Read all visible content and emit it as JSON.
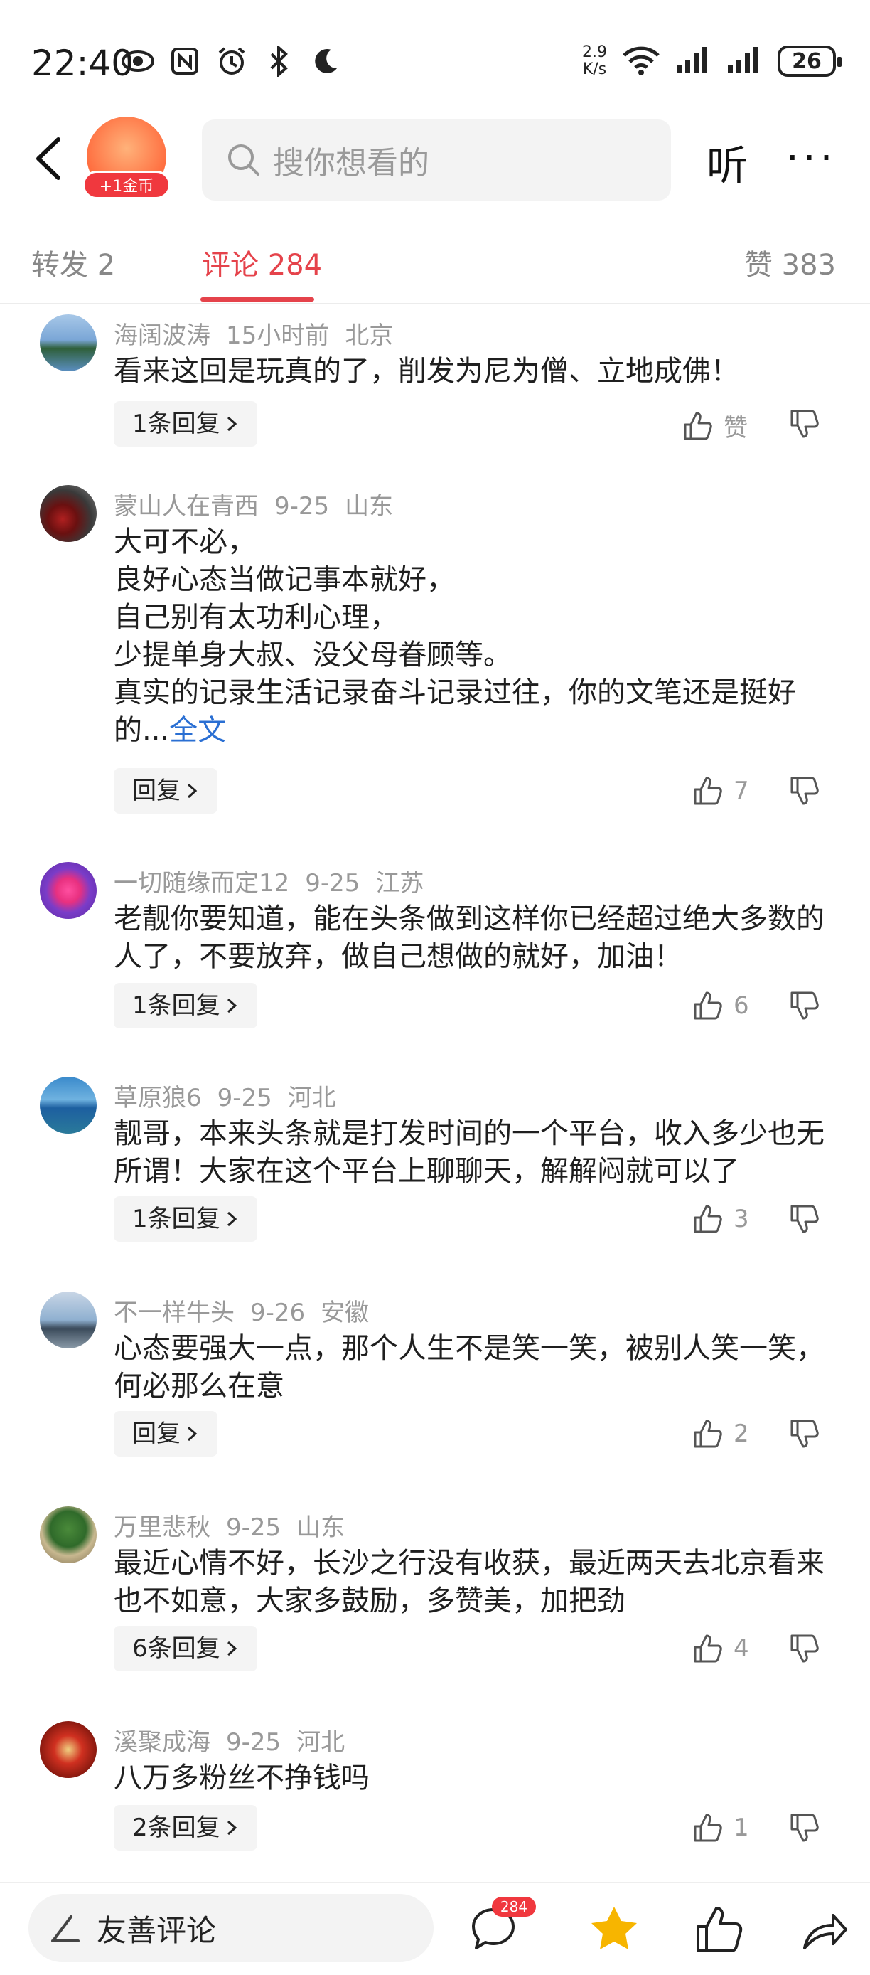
{
  "status_bar": {
    "time": "22:40",
    "net_speed_value": "2.9",
    "net_speed_unit": "K/s",
    "battery": "26"
  },
  "search": {
    "placeholder": "搜你想看的"
  },
  "coin_badge": "+1金币",
  "listen_label": "听",
  "more_label": "···",
  "tabs": {
    "share": "转发 2",
    "comments": "评论 284",
    "likes": "赞 383"
  },
  "comments": [
    {
      "user": "海阔波涛",
      "time": "15小时前",
      "location": "北京",
      "text": "看来这回是玩真的了，削发为尼为僧、立地成佛！",
      "reply": "1条回复",
      "likes": "赞"
    },
    {
      "user": "蒙山人在青西",
      "time": "9-25",
      "location": "山东",
      "text": "大可不必，\n良好心态当做记事本就好，\n自己别有太功利心理，\n少提单身大叔、没父母眷顾等。\n真实的记录生活记录奋斗记录过往，你的文笔还是挺好的...",
      "full_text_label": "全文",
      "reply": "回复",
      "likes": "7"
    },
    {
      "user": "一切随缘而定12",
      "time": "9-25",
      "location": "江苏",
      "text": "老靓你要知道，能在头条做到这样你已经超过绝大多数的人了，不要放弃，做自己想做的就好，加油！",
      "reply": "1条回复",
      "likes": "6"
    },
    {
      "user": "草原狼6",
      "time": "9-25",
      "location": "河北",
      "text": "靓哥，本来头条就是打发时间的一个平台，收入多少也无所谓！大家在这个平台上聊聊天，解解闷就可以了",
      "reply": "1条回复",
      "likes": "3"
    },
    {
      "user": "不一样牛头",
      "time": "9-26",
      "location": "安徽",
      "text": "心态要强大一点，那个人生不是笑一笑，被别人笑一笑，何必那么在意",
      "reply": "回复",
      "likes": "2"
    },
    {
      "user": "万里悲秋",
      "time": "9-25",
      "location": "山东",
      "text": "最近心情不好，长沙之行没有收获，最近两天去北京看来也不如意，大家多鼓励，多赞美，加把劲",
      "reply": "6条回复",
      "likes": "4"
    },
    {
      "user": "溪聚成海",
      "time": "9-25",
      "location": "河北",
      "text": "八万多粉丝不挣钱吗",
      "reply": "2条回复",
      "likes": "1"
    }
  ],
  "bottom_bar": {
    "comment_placeholder": "友善评论",
    "comment_count_badge": "284"
  },
  "colors": {
    "accent": "#e5434b",
    "link": "#2a6fd3",
    "star": "#f7b500"
  }
}
